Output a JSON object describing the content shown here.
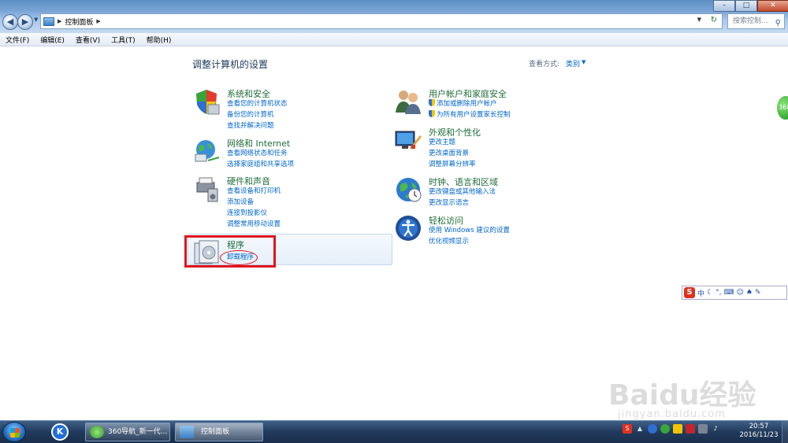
{
  "window": {
    "breadcrumb": "控制面板",
    "search_placeholder": "搜索控制...",
    "controls": {
      "minimize": "–",
      "maximize": "□",
      "close": "✕"
    }
  },
  "menubar": [
    "文件(F)",
    "编辑(E)",
    "查看(V)",
    "工具(T)",
    "帮助(H)"
  ],
  "main": {
    "title": "调整计算机的设置",
    "view_by_label": "查看方式:",
    "view_by_value": "类别"
  },
  "categories": [
    {
      "title": "系统和安全",
      "links": [
        "查看您的计算机状态",
        "备份您的计算机",
        "查找并解决问题"
      ]
    },
    {
      "title": "网络和 Internet",
      "links": [
        "查看网络状态和任务",
        "选择家庭组和共享选项"
      ]
    },
    {
      "title": "硬件和声音",
      "links": [
        "查看设备和打印机",
        "添加设备",
        "连接到投影仪",
        "调整常用移动设置"
      ]
    },
    {
      "title": "程序",
      "links": [
        "卸载程序"
      ]
    },
    {
      "title": "用户帐户和家庭安全",
      "links": [
        "添加或删除用户帐户",
        "为所有用户设置家长控制"
      ]
    },
    {
      "title": "外观和个性化",
      "links": [
        "更改主题",
        "更改桌面背景",
        "调整屏幕分辨率"
      ]
    },
    {
      "title": "时钟、语言和区域",
      "links": [
        "更改键盘或其他输入法",
        "更改显示语言"
      ]
    },
    {
      "title": "轻松访问",
      "links": [
        "使用 Windows 建议的设置",
        "优化视频显示"
      ]
    }
  ],
  "side_badge": "360",
  "ime": {
    "logo": "S",
    "mode": "中"
  },
  "watermark": {
    "text": "Baidu经验",
    "url": "jingyan.baidu.com"
  },
  "taskbar": {
    "kugou_letter": "K",
    "buttons": [
      "360导航_新一代...",
      "控制面板"
    ],
    "clock_time": "20:57",
    "clock_date": "2016/11/23"
  },
  "colors": {
    "accent_link": "#0066cc",
    "category_title": "#1e6c3a",
    "highlight_red": "#e0141d"
  }
}
